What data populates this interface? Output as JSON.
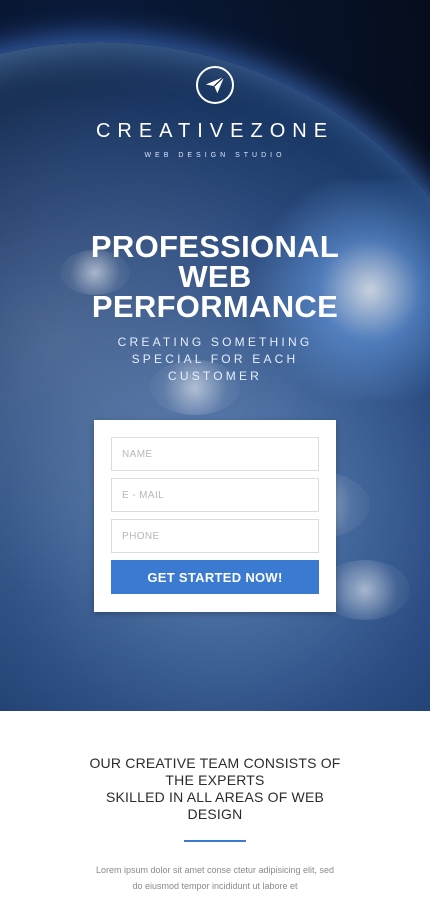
{
  "brand": {
    "name": "CREATIVEZONE",
    "tagline": "WEB DESIGN STUDIO",
    "icon": "paper-plane-icon"
  },
  "hero": {
    "headline": {
      "line1": "PROFESSIONAL",
      "line2": "WEB",
      "line3": "PERFORMANCE"
    },
    "subline": {
      "line1": "CREATING SOMETHING",
      "line2": "SPECIAL FOR EACH",
      "line3": "CUSTOMER"
    }
  },
  "form": {
    "name_placeholder": "NAME",
    "email_placeholder": "E - MAIL",
    "phone_placeholder": "PHONE",
    "submit_label": "GET STARTED NOW!"
  },
  "about": {
    "title_line1": "OUR CREATIVE TEAM CONSISTS OF",
    "title_line2": "THE EXPERTS",
    "title_line3": "SKILLED IN ALL AREAS OF WEB",
    "title_line4": "DESIGN",
    "body_line1": "Lorem ipsum dolor sit amet conse ctetur adipisicing elit, sed",
    "body_line2": "do eiusmod tempor incididunt ut labore et"
  },
  "colors": {
    "accent": "#3b7ad1"
  }
}
